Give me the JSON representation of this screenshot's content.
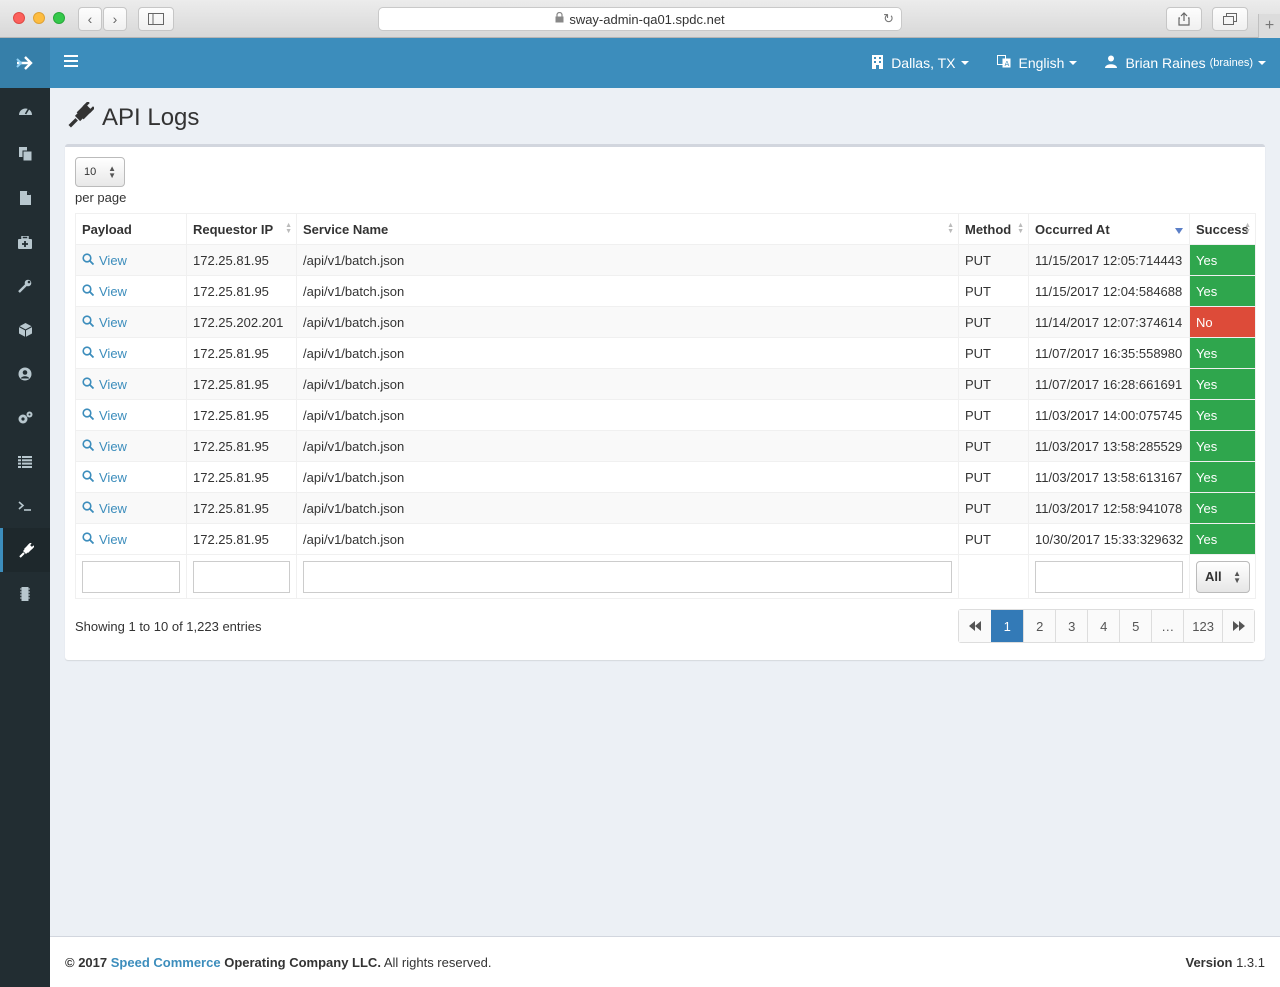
{
  "browser": {
    "url": "sway-admin-qa01.spdc.net",
    "back_icon": "‹",
    "forward_icon": "›",
    "newtab_icon": "+"
  },
  "header": {
    "location": "Dallas, TX",
    "language": "English",
    "user_name": "Brian Raines",
    "user_login": "(braines)"
  },
  "page": {
    "title": "API Logs"
  },
  "table": {
    "per_page_value": "10",
    "per_page_label": "per page",
    "columns": [
      "Payload",
      "Requestor IP",
      "Service Name",
      "Method",
      "Occurred At",
      "Success"
    ],
    "view_label": "View",
    "rows": [
      {
        "ip": "172.25.81.95",
        "service": "/api/v1/batch.json",
        "method": "PUT",
        "occurred": "11/15/2017 12:05:714443",
        "success": "Yes"
      },
      {
        "ip": "172.25.81.95",
        "service": "/api/v1/batch.json",
        "method": "PUT",
        "occurred": "11/15/2017 12:04:584688",
        "success": "Yes"
      },
      {
        "ip": "172.25.202.201",
        "service": "/api/v1/batch.json",
        "method": "PUT",
        "occurred": "11/14/2017 12:07:374614",
        "success": "No"
      },
      {
        "ip": "172.25.81.95",
        "service": "/api/v1/batch.json",
        "method": "PUT",
        "occurred": "11/07/2017 16:35:558980",
        "success": "Yes"
      },
      {
        "ip": "172.25.81.95",
        "service": "/api/v1/batch.json",
        "method": "PUT",
        "occurred": "11/07/2017 16:28:661691",
        "success": "Yes"
      },
      {
        "ip": "172.25.81.95",
        "service": "/api/v1/batch.json",
        "method": "PUT",
        "occurred": "11/03/2017 14:00:075745",
        "success": "Yes"
      },
      {
        "ip": "172.25.81.95",
        "service": "/api/v1/batch.json",
        "method": "PUT",
        "occurred": "11/03/2017 13:58:285529",
        "success": "Yes"
      },
      {
        "ip": "172.25.81.95",
        "service": "/api/v1/batch.json",
        "method": "PUT",
        "occurred": "11/03/2017 13:58:613167",
        "success": "Yes"
      },
      {
        "ip": "172.25.81.95",
        "service": "/api/v1/batch.json",
        "method": "PUT",
        "occurred": "11/03/2017 12:58:941078",
        "success": "Yes"
      },
      {
        "ip": "172.25.81.95",
        "service": "/api/v1/batch.json",
        "method": "PUT",
        "occurred": "10/30/2017 15:33:329632",
        "success": "Yes"
      }
    ],
    "success_filter_value": "All",
    "showing_text": "Showing 1 to 10 of 1,223 entries"
  },
  "pagination": {
    "first": "⏪",
    "pages": [
      "1",
      "2",
      "3",
      "4",
      "5",
      "…",
      "123"
    ],
    "active": "1",
    "last": "⏩"
  },
  "footer": {
    "copyright_prefix": "© 2017",
    "company_link": "Speed Commerce",
    "company_rest": "Operating Company LLC.",
    "rights": "All rights reserved.",
    "version_label": "Version",
    "version_value": "1.3.1"
  },
  "colors": {
    "header": "#3c8dbc",
    "sidebar": "#222d32",
    "success": "#2fa64d",
    "failure": "#dd4b39",
    "link": "#3c8dbc"
  },
  "icons": {
    "sidebar": [
      "dashboard-icon",
      "copy-icon",
      "file-icon",
      "medkit-icon",
      "wrench-icon",
      "cube-icon",
      "user-circle-icon",
      "cogs-icon",
      "list-icon",
      "terminal-icon",
      "plug-icon",
      "memory-chip-icon"
    ]
  }
}
